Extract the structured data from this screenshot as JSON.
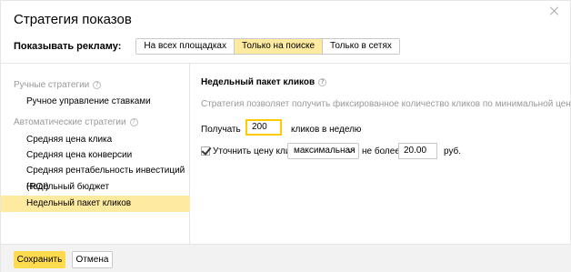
{
  "dialog": {
    "title": "Стратегия показов"
  },
  "show_ads": {
    "label": "Показывать рекламу:",
    "options": [
      "На всех площадках",
      "Только на поиске",
      "Только в сетях"
    ],
    "selected": "Только на поиске"
  },
  "sidebar": {
    "manual_group": "Ручные стратегии",
    "manual_items": [
      "Ручное управление ставками"
    ],
    "auto_group": "Автоматические стратегии",
    "auto_items": [
      "Средняя цена клика",
      "Средняя цена конверсии",
      "Средняя рентабельность инвестиций (ROI)",
      "Недельный бюджет",
      "Недельный пакет кликов"
    ],
    "active_item": "Недельный пакет кликов",
    "help_icon": "question-circle-icon"
  },
  "main": {
    "title": "Недельный пакет кликов",
    "description": "Стратегия позволяет получить фиксированное количество кликов по минимальной цене",
    "get_label": "Получать",
    "clicks_value": "200",
    "clicks_suffix": "кликов в неделю",
    "refine_label": "Уточнить цену клика",
    "refine_checked": true,
    "refine_mode": "максимальная",
    "not_more_label": "не более",
    "price_value": "20.00",
    "currency": "руб."
  },
  "footer": {
    "save_label": "Сохранить",
    "cancel_label": "Отмена"
  },
  "colors": {
    "accent_yellow": "#ffdb4d",
    "active_bg": "#ffeba0",
    "input_focus": "#ffcc00"
  }
}
